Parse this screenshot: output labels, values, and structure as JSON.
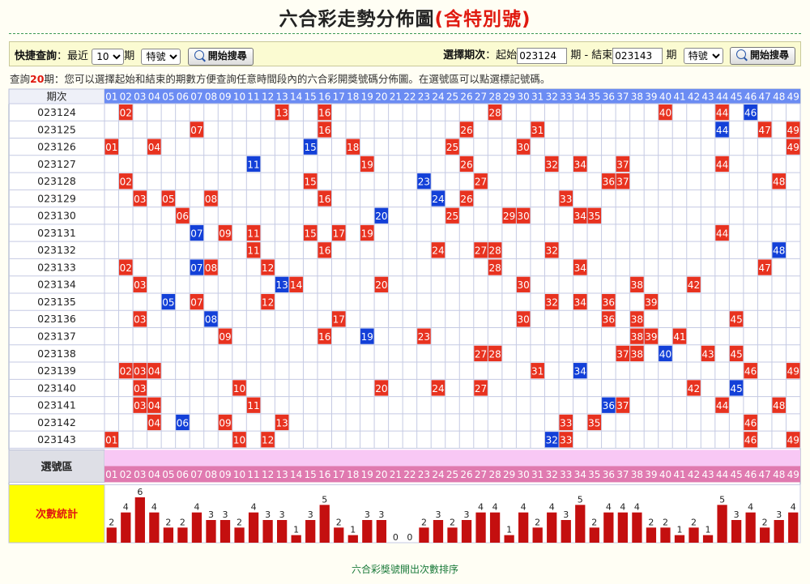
{
  "page": {
    "title_main": "六合彩走勢分佈圖",
    "title_special": "(含特別號)"
  },
  "quick": {
    "label": "快捷查詢",
    "sep": "：",
    "recent_pre": "最近",
    "count": "10",
    "recent_post": "期",
    "type": "特號",
    "search_btn": "開始搜尋"
  },
  "range": {
    "label": "選擇期次",
    "sep": "：",
    "start_label": "起始",
    "start": "023124",
    "mid": "期 - 結束",
    "end": "023143",
    "post": "期",
    "type": "特號",
    "search_btn": "開始搜尋"
  },
  "info": {
    "pre": "查詢",
    "count": "20",
    "post": "期：您可以選擇起始和結束的期數方便查詢任意時間段內的六合彩開獎號碼分佈圖。在選號區可以點選標記號碼。"
  },
  "table": {
    "period_header": "期次",
    "numbers": [
      "01",
      "02",
      "03",
      "04",
      "05",
      "06",
      "07",
      "08",
      "09",
      "10",
      "11",
      "12",
      "13",
      "14",
      "15",
      "16",
      "17",
      "18",
      "19",
      "20",
      "21",
      "22",
      "23",
      "24",
      "25",
      "26",
      "27",
      "28",
      "29",
      "30",
      "31",
      "32",
      "33",
      "34",
      "35",
      "36",
      "37",
      "38",
      "39",
      "40",
      "41",
      "42",
      "43",
      "44",
      "45",
      "46",
      "47",
      "48",
      "49"
    ],
    "rows": [
      {
        "period": "023124",
        "regular": [
          2,
          13,
          16,
          28,
          40,
          44
        ],
        "special": 46
      },
      {
        "period": "023125",
        "regular": [
          7,
          16,
          26,
          31,
          47,
          49
        ],
        "special": 44
      },
      {
        "period": "023126",
        "regular": [
          1,
          4,
          18,
          25,
          30,
          49
        ],
        "special": 15
      },
      {
        "period": "023127",
        "regular": [
          19,
          26,
          32,
          34,
          37,
          44
        ],
        "special": 11
      },
      {
        "period": "023128",
        "regular": [
          2,
          15,
          27,
          36,
          37,
          48
        ],
        "special": 23
      },
      {
        "period": "023129",
        "regular": [
          3,
          5,
          8,
          16,
          26,
          33
        ],
        "special": 24
      },
      {
        "period": "023130",
        "regular": [
          6,
          25,
          29,
          30,
          34,
          35
        ],
        "special": 20
      },
      {
        "period": "023131",
        "regular": [
          9,
          11,
          15,
          17,
          19,
          44
        ],
        "special": 7
      },
      {
        "period": "023132",
        "regular": [
          11,
          16,
          24,
          27,
          28,
          32
        ],
        "special": 48
      },
      {
        "period": "023133",
        "regular": [
          2,
          8,
          12,
          28,
          34,
          47
        ],
        "special": 7
      },
      {
        "period": "023134",
        "regular": [
          3,
          14,
          20,
          30,
          38,
          42
        ],
        "special": 13
      },
      {
        "period": "023135",
        "regular": [
          7,
          12,
          32,
          34,
          36,
          39
        ],
        "special": 5
      },
      {
        "period": "023136",
        "regular": [
          3,
          17,
          30,
          36,
          38,
          45
        ],
        "special": 8
      },
      {
        "period": "023137",
        "regular": [
          9,
          16,
          23,
          38,
          39,
          41
        ],
        "special": 19
      },
      {
        "period": "023138",
        "regular": [
          27,
          28,
          37,
          38,
          43,
          45
        ],
        "special": 40
      },
      {
        "period": "023139",
        "regular": [
          2,
          3,
          4,
          31,
          46,
          49
        ],
        "special": 34
      },
      {
        "period": "023140",
        "regular": [
          3,
          10,
          20,
          24,
          27,
          42
        ],
        "special": 45
      },
      {
        "period": "023141",
        "regular": [
          3,
          4,
          11,
          37,
          44,
          48
        ],
        "special": 36
      },
      {
        "period": "023142",
        "regular": [
          4,
          9,
          13,
          33,
          35,
          46
        ],
        "special": 6
      },
      {
        "period": "023143",
        "regular": [
          1,
          10,
          12,
          33,
          46,
          49
        ],
        "special": 32
      }
    ],
    "select_zone_label": "選號區",
    "stats_label": "次數統計",
    "counts": [
      2,
      4,
      6,
      4,
      2,
      2,
      4,
      3,
      3,
      2,
      4,
      3,
      3,
      1,
      3,
      5,
      2,
      1,
      3,
      3,
      0,
      0,
      2,
      3,
      2,
      3,
      4,
      4,
      1,
      4,
      2,
      4,
      3,
      5,
      2,
      4,
      4,
      4,
      2,
      2,
      1,
      2,
      1,
      5,
      3,
      4,
      2,
      3,
      4
    ]
  },
  "colors": {
    "regular_ball": "#e8321f",
    "special_ball": "#1340d8",
    "header_num_bg": "#6b8cf3",
    "zone_num_bg": "#e07ab0",
    "zone_pink_bg": "#f8c8f5",
    "stats_label_bg": "#ffff00",
    "bar": "#c40f0f"
  },
  "footer": {
    "link": "六合彩獎號開出次數排序"
  }
}
